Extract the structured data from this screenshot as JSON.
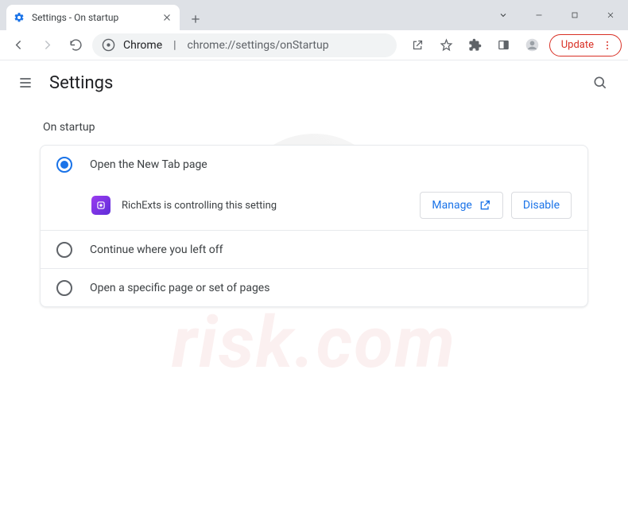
{
  "tab": {
    "title": "Settings - On startup"
  },
  "omnibox": {
    "host": "Chrome",
    "path": "chrome://settings/onStartup"
  },
  "update": {
    "label": "Update"
  },
  "header": {
    "title": "Settings"
  },
  "section": {
    "title": "On startup"
  },
  "options": {
    "opt1": "Open the New Tab page",
    "opt2": "Continue where you left off",
    "opt3": "Open a specific page or set of pages"
  },
  "controller": {
    "message": "RichExts is controlling this setting",
    "manage": "Manage",
    "disable": "Disable"
  }
}
